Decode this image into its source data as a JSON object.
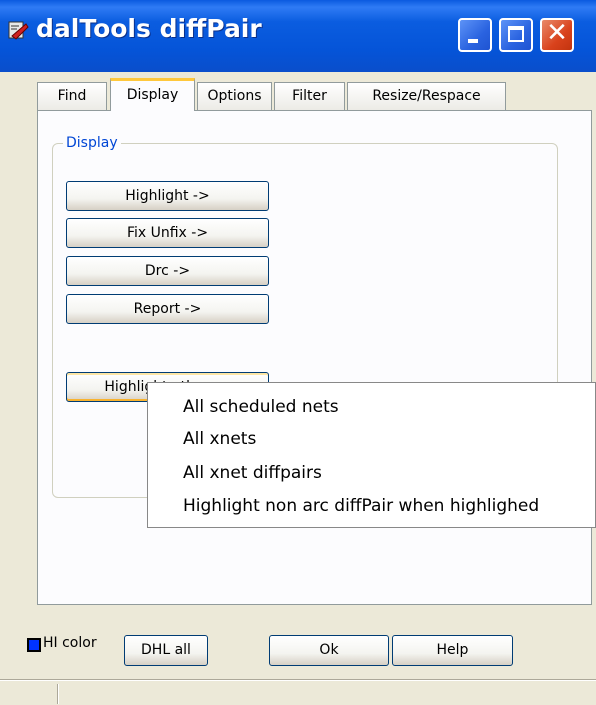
{
  "window": {
    "title": "dalTools diffPair",
    "icon": "daltools-app-icon",
    "controls": [
      "minimize-icon",
      "maximize-icon",
      "close-icon"
    ],
    "close_glyph": "✕"
  },
  "tabs": [
    {
      "label": "Find",
      "active": false
    },
    {
      "label": "Display",
      "active": true
    },
    {
      "label": "Options",
      "active": false
    },
    {
      "label": "Filter",
      "active": false
    },
    {
      "label": "Resize/Respace",
      "active": false
    }
  ],
  "display_group": {
    "label": "Display",
    "buttons": [
      "Highlight ->",
      "Fix Unfix ->",
      "Drc ->",
      "Report ->",
      "Highlight other ->"
    ]
  },
  "popup_menu": {
    "items": [
      "All scheduled nets",
      "All xnets",
      "All xnet diffpairs",
      "Highlight non arc diffPair when highlighed"
    ]
  },
  "bottom": {
    "hi_color_label": "HI color",
    "hi_color_value": "#0033ff",
    "dhl_all_label": "DHL all",
    "ok_label": "Ok",
    "help_label": "Help"
  }
}
